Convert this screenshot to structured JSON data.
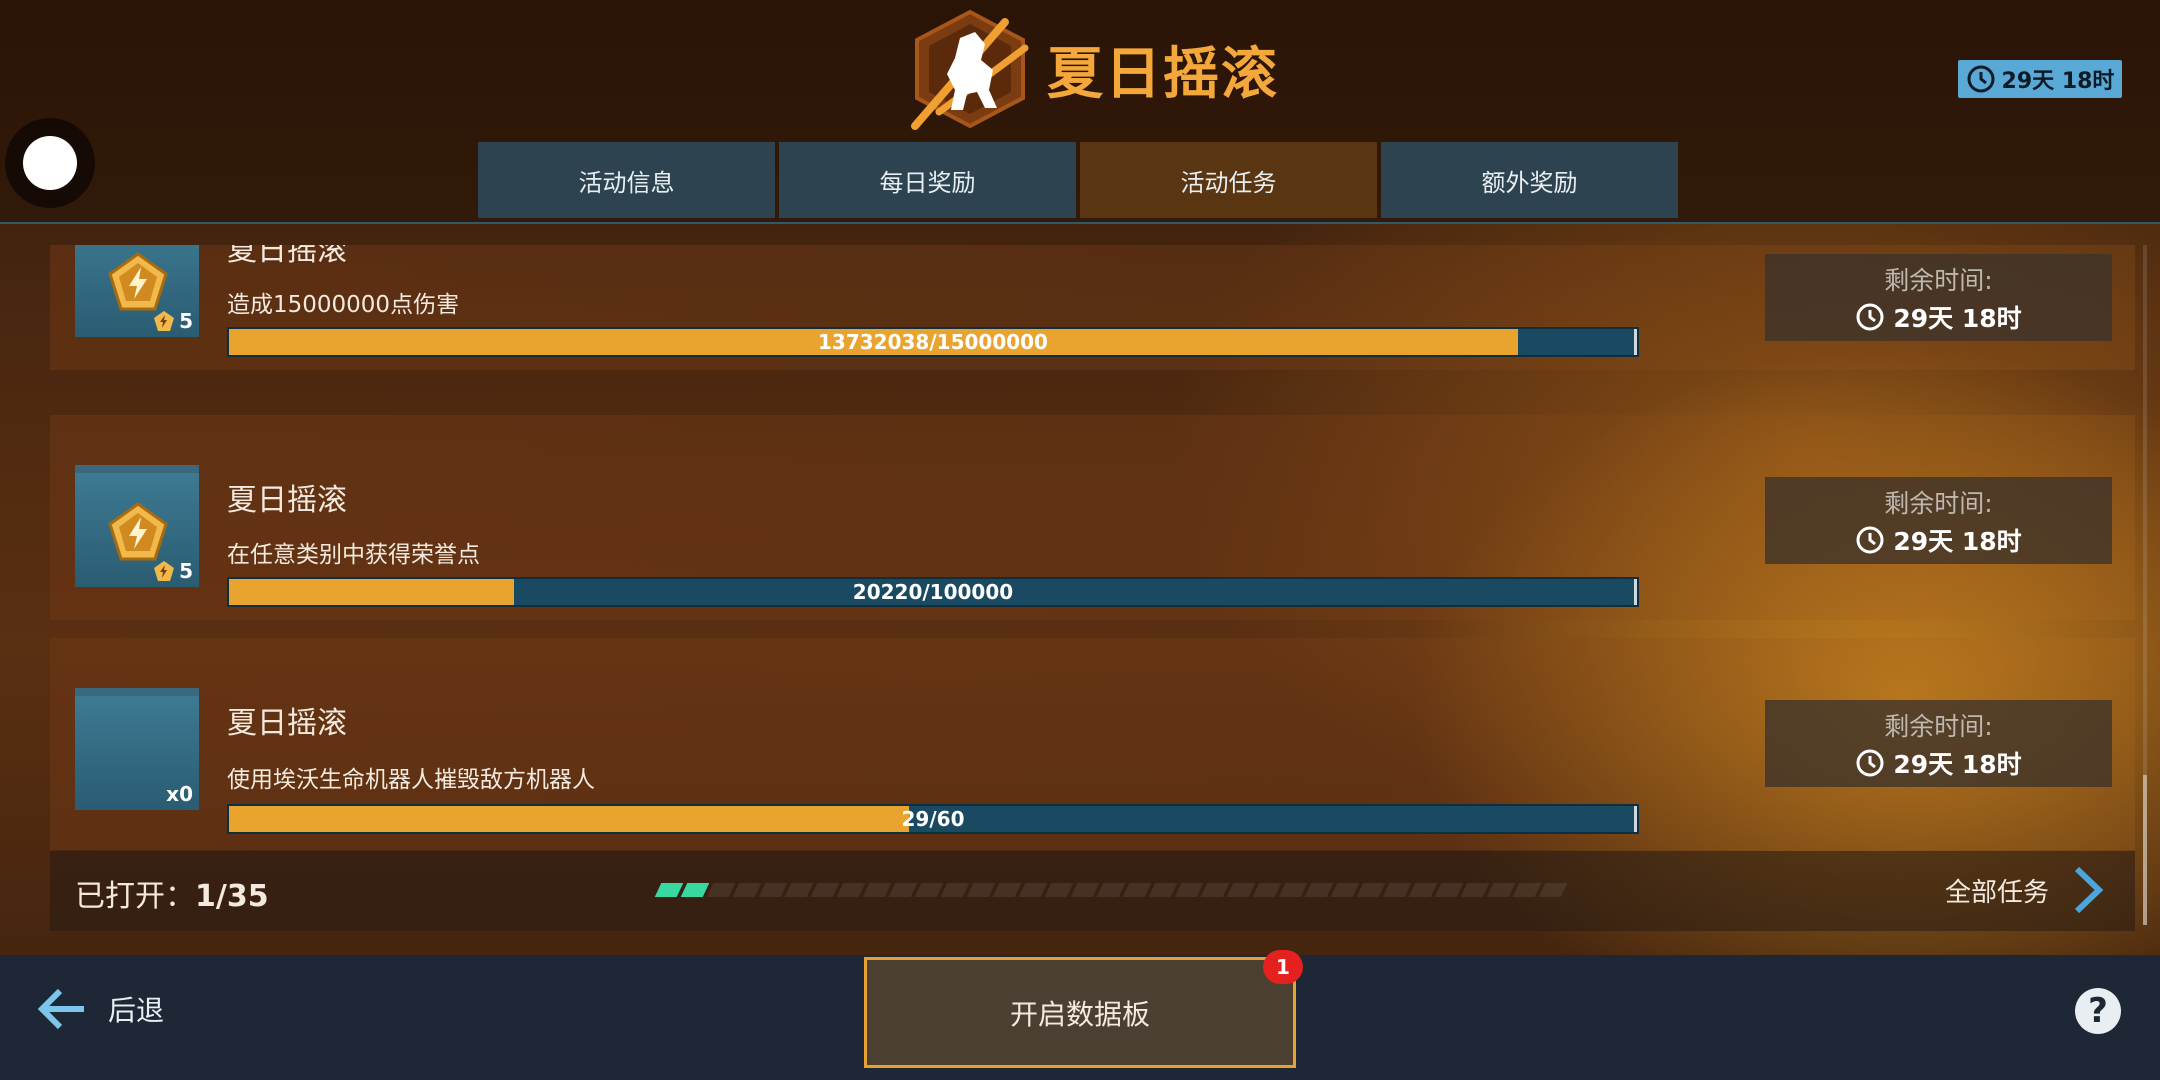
{
  "header": {
    "title": "夏日摇滚",
    "timer": "29天 18时",
    "tabs": [
      {
        "label": "活动信息",
        "active": false
      },
      {
        "label": "每日奖励",
        "active": false
      },
      {
        "label": "活动任务",
        "active": true
      },
      {
        "label": "额外奖励",
        "active": false
      }
    ]
  },
  "tasks": [
    {
      "name": "夏日摇滚",
      "description": "造成15000000点伤害",
      "progress_text": "13732038/15000000",
      "progress_fraction": 0.9155,
      "reward_qty": "5",
      "reward_icon": "honor-pentagon-icon",
      "remaining_label": "剩余时间:",
      "remaining_value": "29天 18时"
    },
    {
      "name": "夏日摇滚",
      "description": "在任意类别中获得荣誉点",
      "progress_text": "20220/100000",
      "progress_fraction": 0.2022,
      "reward_qty": "5",
      "reward_icon": "honor-pentagon-icon",
      "remaining_label": "剩余时间:",
      "remaining_value": "29天 18时"
    },
    {
      "name": "夏日摇滚",
      "description": "使用埃沃生命机器人摧毁敌方机器人",
      "progress_text": "29/60",
      "progress_fraction": 0.4833,
      "reward_qty": "x0",
      "reward_icon": null,
      "remaining_label": "剩余时间:",
      "remaining_value": "29天 18时"
    }
  ],
  "footer": {
    "opened_label": "已打开：",
    "opened_value": "1/35",
    "opened_count": 1,
    "opened_total": 35,
    "all_tasks_label": "全部任务"
  },
  "bottom": {
    "back_label": "后退",
    "datapad_label": "开启数据板",
    "datapad_badge": "1",
    "help_label": "?"
  },
  "colors": {
    "accent": "#e9a430",
    "title": "#f4a73a",
    "progress_track": "#1a4a62",
    "tab": "#2d4450",
    "tab_active": "#5a3512",
    "dot_active": "#37d9a0",
    "badge": "#e4211f"
  }
}
